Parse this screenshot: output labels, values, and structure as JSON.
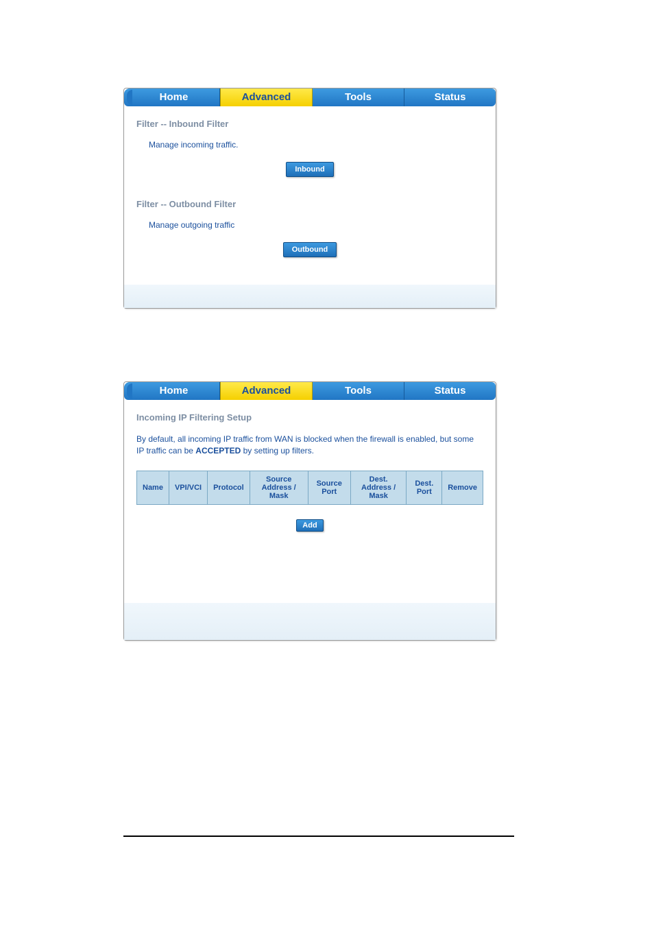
{
  "tabs": [
    "Home",
    "Advanced",
    "Tools",
    "Status"
  ],
  "active_tab": "Advanced",
  "panel1": {
    "inbound_title": "Filter -- Inbound Filter",
    "inbound_desc": "Manage incoming traffic.",
    "inbound_btn": "Inbound",
    "outbound_title": "Filter -- Outbound Filter",
    "outbound_desc": "Manage outgoing traffic",
    "outbound_btn": "Outbound"
  },
  "panel2": {
    "title": "Incoming IP Filtering Setup",
    "desc_pre": "By default, all incoming IP traffic from WAN is blocked when the firewall is enabled, but some IP traffic can be ",
    "desc_bold": "ACCEPTED",
    "desc_post": " by setting up filters.",
    "headers": [
      "Name",
      "VPI/VCI",
      "Protocol",
      "Source Address / Mask",
      "Source Port",
      "Dest. Address / Mask",
      "Dest. Port",
      "Remove"
    ],
    "add_btn": "Add"
  }
}
